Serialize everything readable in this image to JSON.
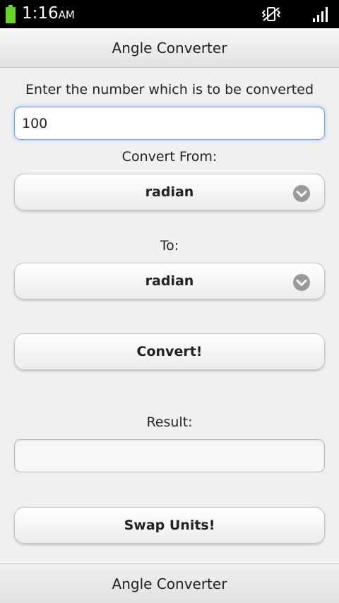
{
  "status_bar": {
    "time": "1:16",
    "ampm": "AM",
    "battery_icon": "battery-charging-icon",
    "vibrate_icon": "vibrate-icon",
    "signal_icon": "signal-icon"
  },
  "header": {
    "title": "Angle Converter"
  },
  "form": {
    "prompt_label": "Enter the number which is to be converted",
    "number_value": "100",
    "from_label": "Convert From:",
    "from_value": "radian",
    "to_label": "To:",
    "to_value": "radian",
    "convert_button": "Convert!",
    "result_label": "Result:",
    "result_value": "",
    "swap_button": "Swap Units!"
  },
  "footer": {
    "title": "Angle Converter"
  },
  "colors": {
    "status_bar_bg": "#000000",
    "battery_green": "#6ad12c",
    "input_focus_blue": "#7fa7d6"
  }
}
